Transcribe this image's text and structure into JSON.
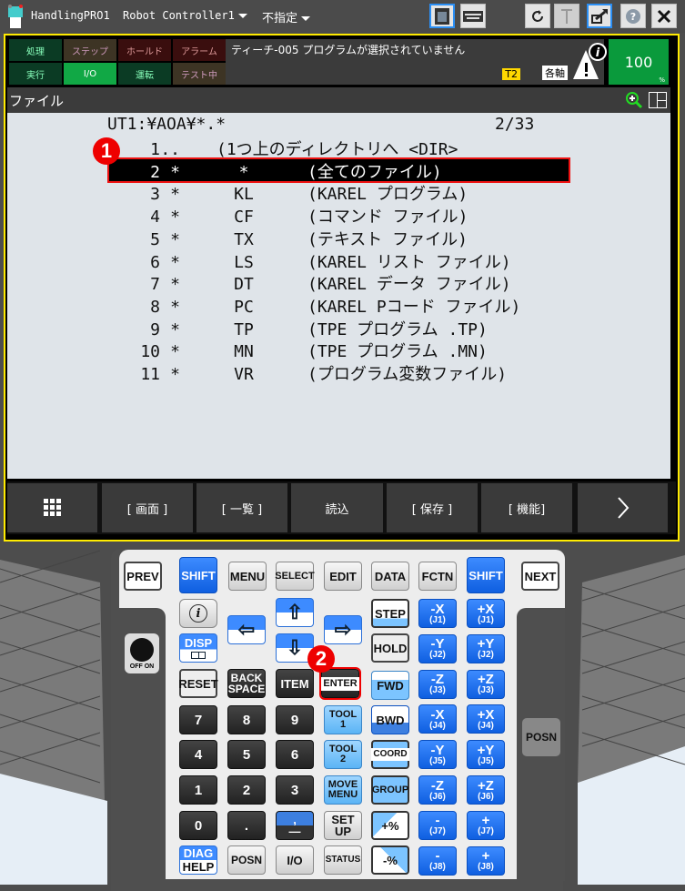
{
  "titlebar": {
    "app_name": "HandlingPRO1",
    "controller": "Robot Controller1",
    "group": "不指定",
    "buttons": [
      "teach-pendant-icon",
      "keyboard-icon",
      "refresh-icon",
      "robot-axis-icon",
      "external-window-icon",
      "help-icon",
      "close-icon"
    ]
  },
  "status": {
    "indicators": [
      {
        "label": "処理",
        "active": false
      },
      {
        "label": "ステップ",
        "active": false
      },
      {
        "label": "ホールド",
        "active": false
      },
      {
        "label": "アラーム",
        "active": false
      },
      {
        "label": "実行",
        "active": false
      },
      {
        "label": "I/O",
        "active": true
      },
      {
        "label": "運転",
        "active": false
      },
      {
        "label": "テスト中",
        "active": false
      }
    ],
    "message": "ティーチ-005 プログラムが選択されていません",
    "tool_badge": "T2",
    "coord_badge": "各軸",
    "override": "100",
    "override_unit": "%"
  },
  "screen": {
    "title": "ファイル",
    "path": "UT1:¥AOA¥*.*",
    "position": "2/33",
    "rows": [
      {
        "no": "1",
        "star": "..",
        "ext": "",
        "desc": "(1つ上のディレクトリへ <DIR>"
      },
      {
        "no": "2",
        "star": "*",
        "ext": "*",
        "desc": "(全てのファイル)"
      },
      {
        "no": "3",
        "star": "*",
        "ext": "KL",
        "desc": "(KAREL プログラム)"
      },
      {
        "no": "4",
        "star": "*",
        "ext": "CF",
        "desc": "(コマンド ファイル)"
      },
      {
        "no": "5",
        "star": "*",
        "ext": "TX",
        "desc": "(テキスト ファイル)"
      },
      {
        "no": "6",
        "star": "*",
        "ext": "LS",
        "desc": "(KAREL リスト ファイル)"
      },
      {
        "no": "7",
        "star": "*",
        "ext": "DT",
        "desc": "(KAREL データ ファイル)"
      },
      {
        "no": "8",
        "star": "*",
        "ext": "PC",
        "desc": "(KAREL Pコード ファイル)"
      },
      {
        "no": "9",
        "star": "*",
        "ext": "TP",
        "desc": "(TPE プログラム .TP)"
      },
      {
        "no": "10",
        "star": "*",
        "ext": "MN",
        "desc": "(TPE プログラム .MN)"
      },
      {
        "no": "11",
        "star": "*",
        "ext": "VR",
        "desc": "(プログラム変数ファイル)"
      }
    ],
    "selected_row": 2
  },
  "softkeys": [
    "[ 画面 ]",
    "[ 一覧 ]",
    "読込",
    "[ 保存 ]",
    "[ 機能]"
  ],
  "callouts": [
    "1",
    "2"
  ],
  "keypad": {
    "prev": "PREV",
    "next": "NEXT",
    "shift": "SHIFT",
    "menu": "MENU",
    "select": "SELECT",
    "edit": "EDIT",
    "data": "DATA",
    "fctn": "FCTN",
    "info": "i",
    "disp": "DISP",
    "reset": "RESET",
    "backspace": [
      "BACK",
      "SPACE"
    ],
    "item": "ITEM",
    "enter": "ENTER",
    "step": "STEP",
    "hold": "HOLD",
    "fwd": "FWD",
    "bwd": "BWD",
    "coord": "COORD",
    "group": "GROUP",
    "plus_pct": "+%",
    "minus_pct": "-%",
    "tool1": [
      "TOOL",
      "1"
    ],
    "tool2": [
      "TOOL",
      "2"
    ],
    "move_menu": [
      "MOVE",
      "MENU"
    ],
    "setup": [
      "SET",
      "UP"
    ],
    "status": "STATUS",
    "diag_help": [
      "DIAG",
      "HELP"
    ],
    "posn": "POSN",
    "io": "I/O",
    "side_posn": "POSN",
    "off": "OFF",
    "on": "ON",
    "digits": [
      "7",
      "8",
      "9",
      "4",
      "5",
      "6",
      "1",
      "2",
      "3",
      "0",
      "."
    ],
    "jog": [
      [
        "-X",
        "(J1)"
      ],
      [
        "+X",
        "(J1)"
      ],
      [
        "-Y",
        "(J2)"
      ],
      [
        "+Y",
        "(J2)"
      ],
      [
        "-Z",
        "(J3)"
      ],
      [
        "+Z",
        "(J3)"
      ],
      [
        "-X",
        "(J4)"
      ],
      [
        "+X",
        "(J4)"
      ],
      [
        "-Y",
        "(J5)"
      ],
      [
        "+Y",
        "(J5)"
      ],
      [
        "-Z",
        "(J6)"
      ],
      [
        "+Z",
        "(J6)"
      ],
      [
        "-",
        "(J7)"
      ],
      [
        "+",
        "(J7)"
      ],
      [
        "-",
        "(J8)"
      ],
      [
        "+",
        "(J8)"
      ]
    ]
  }
}
